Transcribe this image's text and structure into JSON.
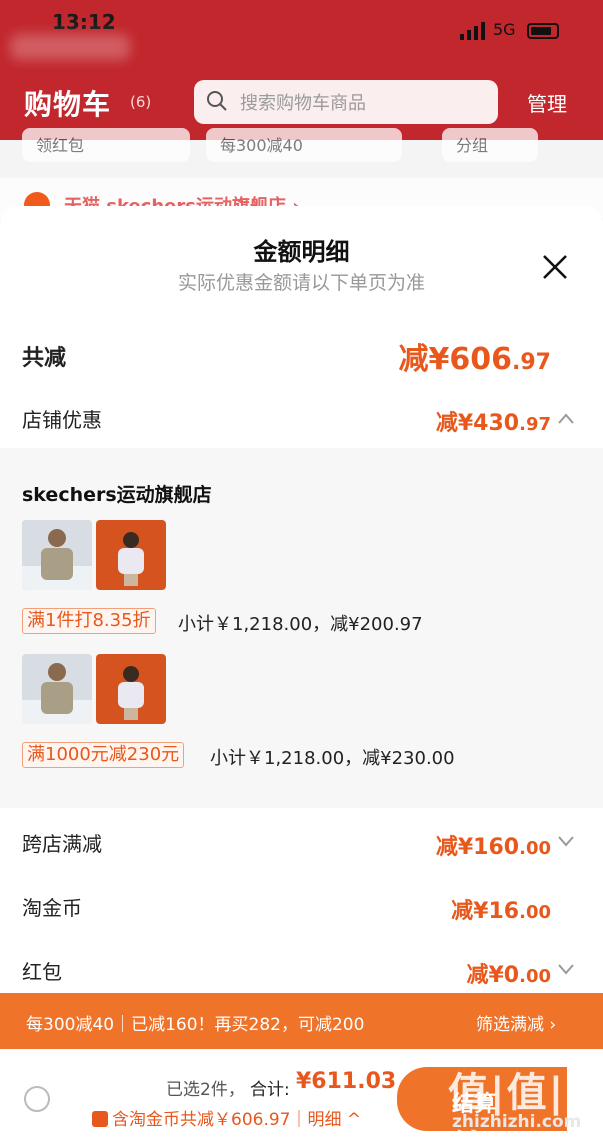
{
  "status": {
    "time": "13:12",
    "network": "5G"
  },
  "header": {
    "title": "购物车",
    "count": "(6)",
    "search_placeholder": "搜索购物车商品",
    "manage": "管理"
  },
  "bg": {
    "chips": [
      "领红包",
      "每300减40",
      "分组"
    ],
    "store": "天猫 skechers运动旗舰店 ›"
  },
  "sheet": {
    "title": "金额明细",
    "subtitle": "实际优惠金额请以下单页为准",
    "total": {
      "label": "共减",
      "prefix": "减¥",
      "int": "606",
      "dec": ".97"
    },
    "store_discount": {
      "label": "店铺优惠",
      "prefix": "减¥",
      "int": "430",
      "dec": ".97"
    },
    "detail": {
      "shop": "skechers运动旗舰店",
      "items": [
        {
          "promo": "满1件打8.35折",
          "subtotal": "小计￥1,218.00，减¥200.97"
        },
        {
          "promo": "满1000元减230元",
          "subtotal": "小计￥1,218.00，减¥230.00"
        }
      ]
    },
    "cross_store": {
      "label": "跨店满减",
      "prefix": "减¥",
      "int": "160",
      "dec": ".00"
    },
    "coins": {
      "label": "淘金币",
      "prefix": "减¥",
      "int": "16",
      "dec": ".00"
    },
    "red_packet": {
      "label": "红包",
      "prefix": "减¥",
      "int": "0",
      "dec": ".00"
    }
  },
  "promo_bar": {
    "text": "每300减40｜已减160！再买282，可减200",
    "link": "筛选满减 ›"
  },
  "bottom": {
    "selected": "已选2件，",
    "total_label": "合计:",
    "total_amount": "¥611.03",
    "coin_text": "含淘金币共减￥606.97｜明细 ^",
    "checkout": "结算"
  },
  "watermark": {
    "logo": "值|值|值",
    "site": "zhizhizhi.com"
  },
  "colors": {
    "accent": "#e8581c",
    "header": "#c1272d",
    "bar": "#f0732a"
  }
}
